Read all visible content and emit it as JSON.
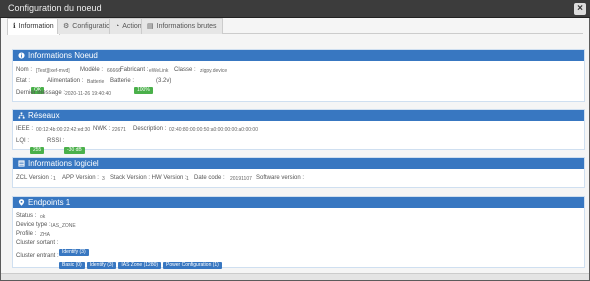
{
  "window": {
    "title": "Configuration du noeud",
    "close_glyph": "×"
  },
  "tabs": [
    {
      "label": "Information",
      "icon": "info-icon"
    },
    {
      "label": "Configuration",
      "icon": "gear-icon"
    },
    {
      "label": "Action",
      "icon": "dashboard-icon"
    },
    {
      "label": "Informations brutes",
      "icon": "table-icon"
    }
  ],
  "noeud": {
    "title": "Informations Noeud",
    "nom_label": "Nom :",
    "nom_value": "[Test][ixef-mvd]",
    "modele_label": "Modèle :",
    "modele_value": "66666",
    "fabricant_label": "Fabricant :",
    "fabricant_value": "eWeLink",
    "classe_label": "Classe :",
    "classe_value": "zigpy.device",
    "etat_label": "Etat :",
    "etat_value": "OK",
    "alimentation_label": "Alimentation :",
    "alimentation_value": "Batterie",
    "batterie_label": "Batterie :",
    "batterie_value": "100%",
    "batterie_extra": "(3.2v)",
    "dernier_label": "Dernier message :",
    "dernier_value": "2020-11-26 19:40:40"
  },
  "reseaux": {
    "title": "Réseaux",
    "ieee_label": "IEEE :",
    "ieee_value": "00:12:4b:00:22:42:ed:30",
    "nwk_label": "NWK :",
    "nwk_value": "22671",
    "description_label": "Description :",
    "description_value": "02:40:80:00:00:50:a0:00:00:00:a0:00:00",
    "lqi_label": "LQI :",
    "lqi_value": "255",
    "rssi_label": "RSSI :",
    "rssi_value": "-30 dB"
  },
  "logiciel": {
    "title": "Informations logiciel",
    "zcl_label": "ZCL Version :",
    "zcl_value": "1",
    "app_label": "APP Version :",
    "app_value": "3",
    "stack_label": "Stack Version : HW Version :",
    "stack_value": "1",
    "date_label": "Date code :",
    "date_value": "20191107",
    "sw_label": "Software version :",
    "sw_value": ""
  },
  "endpoints": {
    "title": "Endpoints 1",
    "status_label": "Status :",
    "status_value": "ok",
    "device_label": "Device type :",
    "device_value": "IAS_ZONE",
    "profile_label": "Profile :",
    "profile_value": "ZHA",
    "sortant_label": "Cluster sortant :",
    "sortant_items": [
      "Identify (3)"
    ],
    "entrant_label": "Cluster entrant :",
    "entrant_items": [
      "Basic (0)",
      "Identify (3)",
      "IAS Zone (1280)",
      "Power Configuration (1)"
    ]
  },
  "colors": {
    "panel_header": "#3877c1",
    "badge_green": "#4ab04a",
    "badge_blue": "#3877c1"
  }
}
